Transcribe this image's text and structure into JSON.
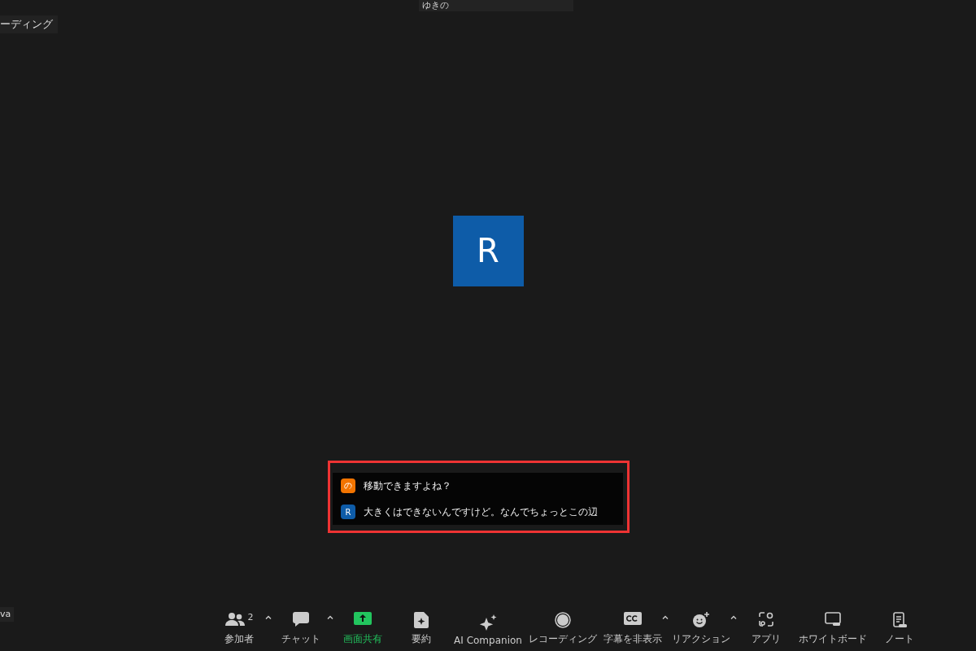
{
  "top_name_tag": "ゆきの",
  "recording_tag": "ーディング",
  "avatar": {
    "initial": "R"
  },
  "captions": [
    {
      "initial": "の",
      "color": "#f27400",
      "text": "移動できますよね？"
    },
    {
      "initial": "R",
      "color": "#0e5ca8",
      "text": "大きくはできないんですけど。なんでちょっとこの辺"
    }
  ],
  "self_name_tag": "va",
  "toolbar": [
    {
      "kind": "participants",
      "label": "参加者",
      "count": "2",
      "has_menu": true
    },
    {
      "kind": "chat",
      "label": "チャット",
      "has_menu": true
    },
    {
      "kind": "share",
      "label": "画面共有",
      "has_menu": false
    },
    {
      "kind": "summary",
      "label": "要約",
      "has_menu": false
    },
    {
      "kind": "ai",
      "label": "AI Companion",
      "has_menu": false
    },
    {
      "kind": "record",
      "label": "レコーディング",
      "has_menu": false
    },
    {
      "kind": "captions",
      "label": "字幕を非表示",
      "has_menu": true
    },
    {
      "kind": "reactions",
      "label": "リアクション",
      "has_menu": true
    },
    {
      "kind": "apps",
      "label": "アプリ",
      "has_menu": false
    },
    {
      "kind": "whiteboard",
      "label": "ホワイトボード",
      "has_menu": false
    },
    {
      "kind": "notes",
      "label": "ノート",
      "has_menu": false
    }
  ]
}
